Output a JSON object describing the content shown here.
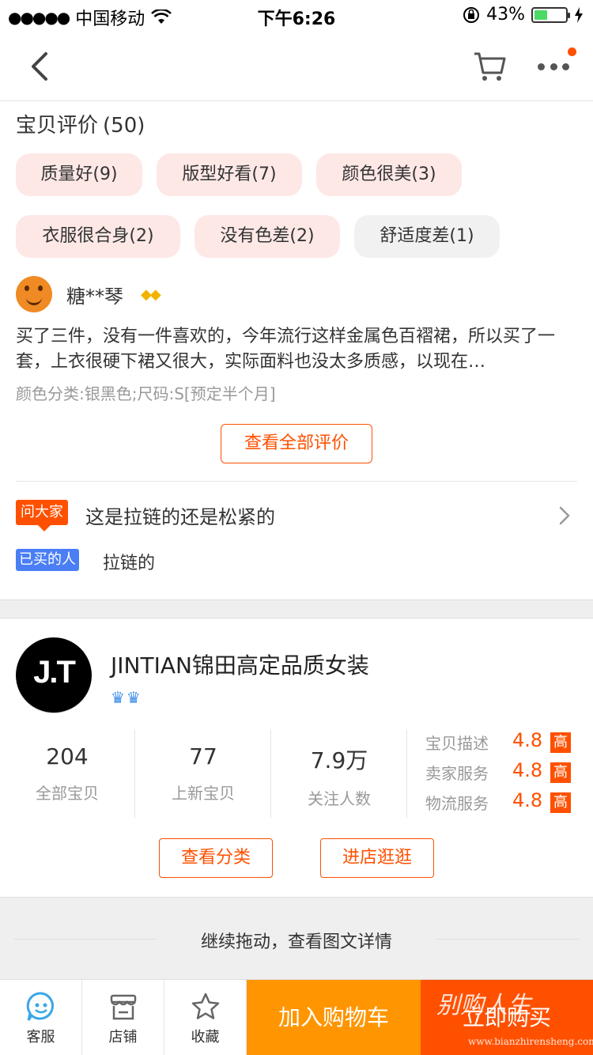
{
  "status_bar": {
    "carrier": "中国移动",
    "time": "下午6:26",
    "battery_percent": "43%",
    "battery_level": 0.43
  },
  "reviews": {
    "title": "宝贝评价",
    "count": "(50)",
    "tags": [
      {
        "label": "质量好(9)",
        "tone": "positive"
      },
      {
        "label": "版型好看(7)",
        "tone": "positive"
      },
      {
        "label": "颜色很美(3)",
        "tone": "positive"
      },
      {
        "label": "衣服很合身(2)",
        "tone": "positive"
      },
      {
        "label": "没有色差(2)",
        "tone": "positive"
      },
      {
        "label": "舒适度差(1)",
        "tone": "negative"
      }
    ],
    "reviewer_name": "糖**琴",
    "review_text": "买了三件，没有一件喜欢的，今年流行这样金属色百褶裙，所以买了一套，上衣很硬下裙又很大，实际面料也没太多质感，以现在…",
    "sku": "颜色分类:银黑色;尺码:S[预定半个月]",
    "all_reviews_button": "查看全部评价"
  },
  "ask": {
    "badge": "问大家",
    "question": "这是拉链的还是松紧的",
    "answer_badge": "已买的人",
    "answer": "拉链的"
  },
  "shop": {
    "logo_text": "J.T",
    "name": "JINTIAN锦田高定品质女装",
    "stats": [
      {
        "value": "204",
        "label": "全部宝贝"
      },
      {
        "value": "77",
        "label": "上新宝贝"
      },
      {
        "value": "7.9万",
        "label": "关注人数"
      }
    ],
    "ratings": [
      {
        "label": "宝贝描述",
        "score": "4.8",
        "level": "高"
      },
      {
        "label": "卖家服务",
        "score": "4.8",
        "level": "高"
      },
      {
        "label": "物流服务",
        "score": "4.8",
        "level": "高"
      }
    ],
    "view_categories_button": "查看分类",
    "enter_shop_button": "进店逛逛"
  },
  "detail_hint": "继续拖动，查看图文详情",
  "bottom_bar": {
    "service": "客服",
    "shop": "店铺",
    "favorite": "收藏",
    "add_to_cart": "加入购物车",
    "buy_now": "立即购买"
  },
  "watermark": {
    "text": "别购人生",
    "url": "www.bianzhirensheng.com"
  },
  "colors": {
    "accent": "#ff5000",
    "add_cart": "#ff9500",
    "tag_bg": "#fde8e6",
    "answer_badge": "#4a7ef5"
  }
}
